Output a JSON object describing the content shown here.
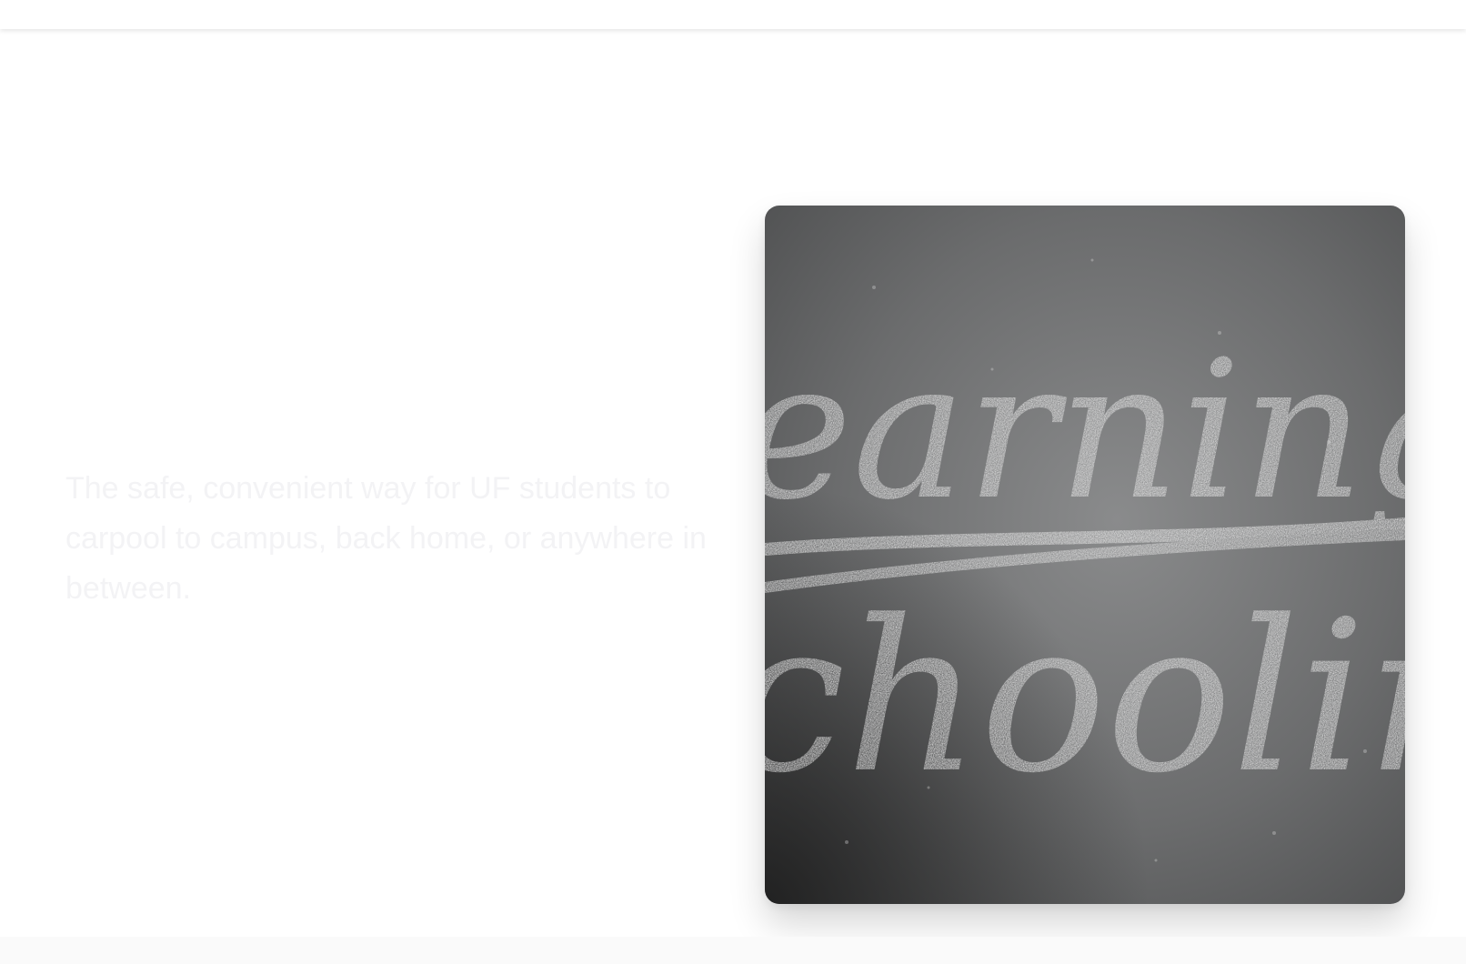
{
  "hero": {
    "tagline": "The safe, convenient way for UF students to carpool to campus, back home, or anywhere in between.",
    "image": {
      "icon": "chalkboard-photo",
      "word_top": "earning",
      "word_bottom": "choolin",
      "colors": {
        "board": "#6b6c6d",
        "board_dark": "#2a2a2a",
        "chalk": "#e6e6e6"
      }
    }
  },
  "colors": {
    "page_bg": "#ffffff",
    "tagline": "#f3f3f5"
  }
}
